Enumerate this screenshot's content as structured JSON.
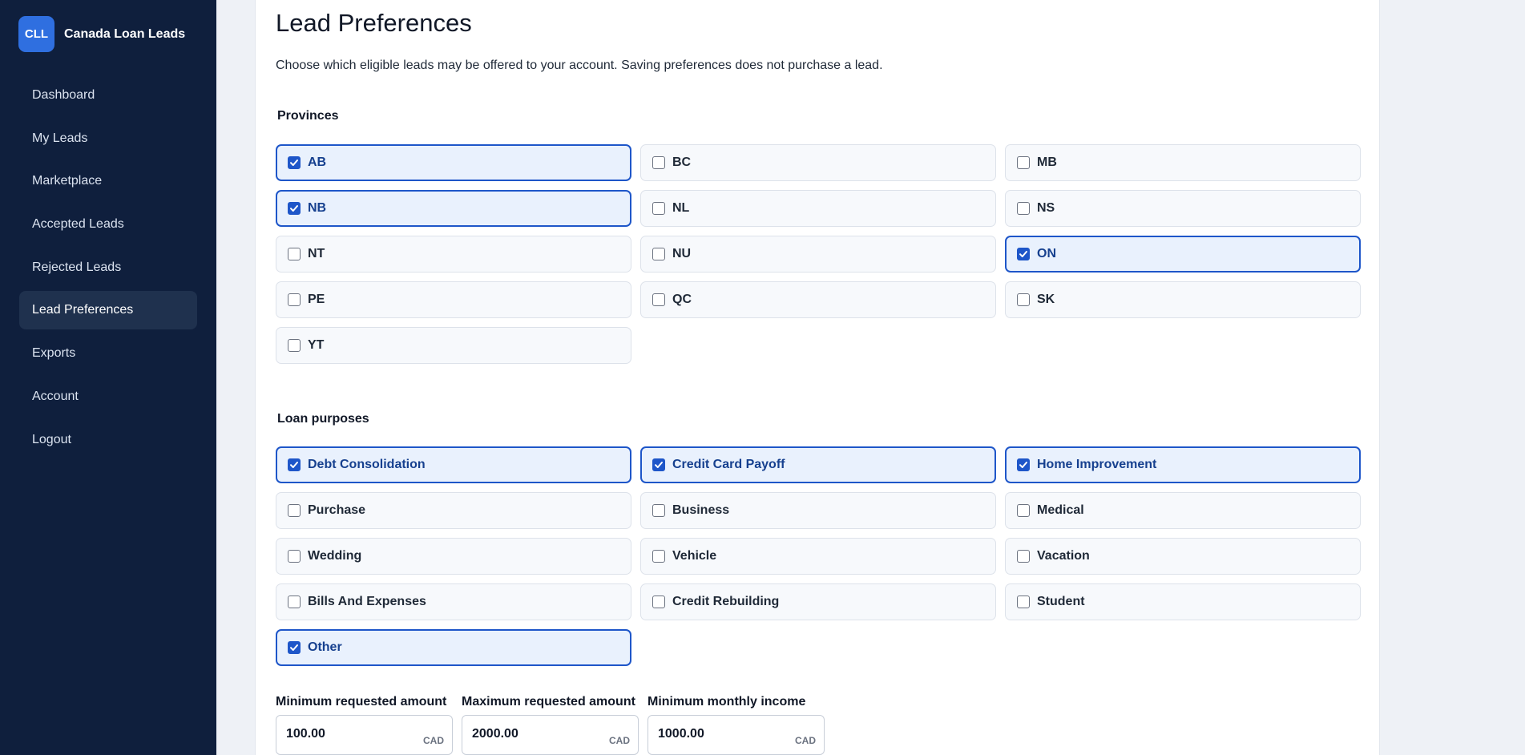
{
  "brand": {
    "logo_text": "CLL",
    "name": "Canada Loan Leads"
  },
  "nav": {
    "items": [
      {
        "label": "Dashboard",
        "active": false
      },
      {
        "label": "My Leads",
        "active": false
      },
      {
        "label": "Marketplace",
        "active": false
      },
      {
        "label": "Accepted Leads",
        "active": false
      },
      {
        "label": "Rejected Leads",
        "active": false
      },
      {
        "label": "Lead Preferences",
        "active": true
      },
      {
        "label": "Exports",
        "active": false
      },
      {
        "label": "Account",
        "active": false
      },
      {
        "label": "Logout",
        "active": false
      }
    ]
  },
  "page": {
    "title": "Lead Preferences",
    "description": "Choose which eligible leads may be offered to your account. Saving preferences does not purchase a lead."
  },
  "provinces": {
    "title": "Provinces",
    "options": [
      {
        "label": "AB",
        "checked": true
      },
      {
        "label": "BC",
        "checked": false
      },
      {
        "label": "MB",
        "checked": false
      },
      {
        "label": "NB",
        "checked": true
      },
      {
        "label": "NL",
        "checked": false
      },
      {
        "label": "NS",
        "checked": false
      },
      {
        "label": "NT",
        "checked": false
      },
      {
        "label": "NU",
        "checked": false
      },
      {
        "label": "ON",
        "checked": true
      },
      {
        "label": "PE",
        "checked": false
      },
      {
        "label": "QC",
        "checked": false
      },
      {
        "label": "SK",
        "checked": false
      },
      {
        "label": "YT",
        "checked": false
      }
    ]
  },
  "purposes": {
    "title": "Loan purposes",
    "options": [
      {
        "label": "Debt Consolidation",
        "checked": true
      },
      {
        "label": "Credit Card Payoff",
        "checked": true
      },
      {
        "label": "Home Improvement",
        "checked": true
      },
      {
        "label": "Purchase",
        "checked": false
      },
      {
        "label": "Business",
        "checked": false
      },
      {
        "label": "Medical",
        "checked": false
      },
      {
        "label": "Wedding",
        "checked": false
      },
      {
        "label": "Vehicle",
        "checked": false
      },
      {
        "label": "Vacation",
        "checked": false
      },
      {
        "label": "Bills And Expenses",
        "checked": false
      },
      {
        "label": "Credit Rebuilding",
        "checked": false
      },
      {
        "label": "Student",
        "checked": false
      },
      {
        "label": "Other",
        "checked": true
      }
    ]
  },
  "amounts": {
    "min_amount": {
      "label": "Minimum requested amount",
      "value": "100.00",
      "unit": "CAD"
    },
    "max_amount": {
      "label": "Maximum requested amount",
      "value": "2000.00",
      "unit": "CAD"
    },
    "min_income": {
      "label": "Minimum monthly income",
      "value": "1000.00",
      "unit": "CAD"
    }
  },
  "colors": {
    "sidebar_bg": "#0f1f3d",
    "accent": "#1e56c9",
    "checked_bg": "#e9f1fd",
    "brand_logo_bg": "#2f6fe0"
  }
}
